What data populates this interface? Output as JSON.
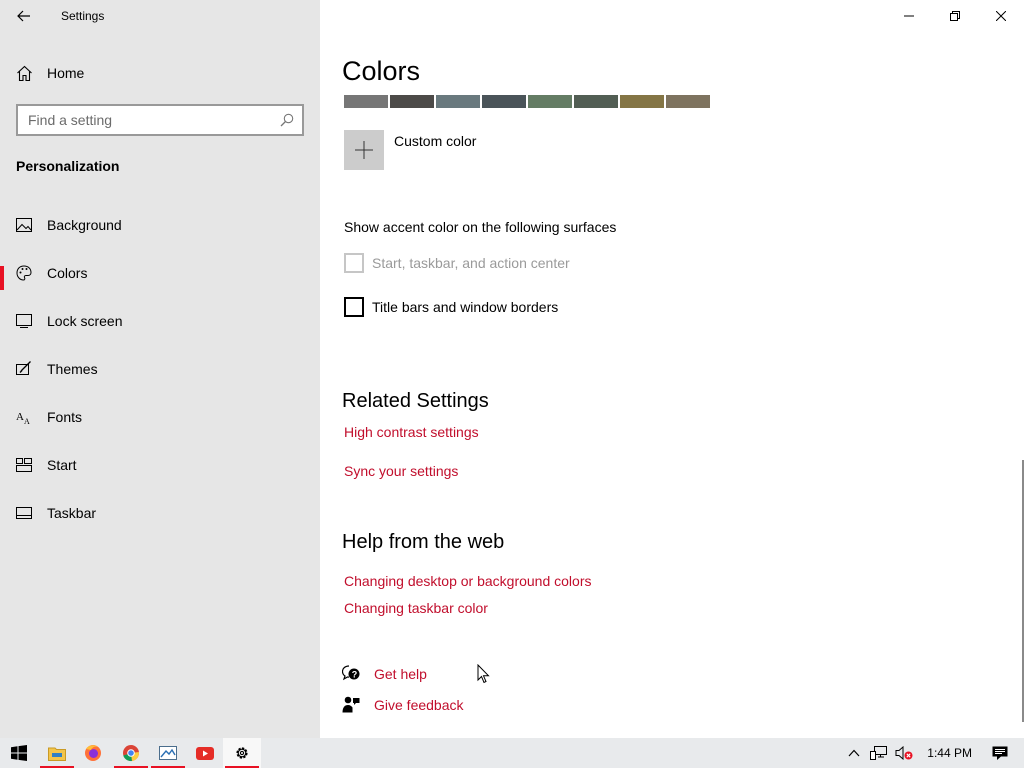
{
  "window": {
    "title": "Settings",
    "accent_color": "#c10e2c",
    "selection_color": "#e81123"
  },
  "sidebar": {
    "home_label": "Home",
    "search_placeholder": "Find a setting",
    "section_title": "Personalization",
    "items": [
      {
        "label": "Background",
        "icon": "picture-icon"
      },
      {
        "label": "Colors",
        "icon": "palette-icon",
        "selected": true
      },
      {
        "label": "Lock screen",
        "icon": "lock-screen-icon"
      },
      {
        "label": "Themes",
        "icon": "themes-icon"
      },
      {
        "label": "Fonts",
        "icon": "fonts-icon"
      },
      {
        "label": "Start",
        "icon": "start-icon"
      },
      {
        "label": "Taskbar",
        "icon": "taskbar-icon"
      }
    ]
  },
  "main": {
    "title": "Colors",
    "swatches": [
      "#767676",
      "#4c4a48",
      "#69797e",
      "#4a5459",
      "#647c64",
      "#525e54",
      "#847545",
      "#7e735f"
    ],
    "custom_color_label": "Custom color",
    "surfaces_label": "Show accent color on the following surfaces",
    "checkboxes": [
      {
        "label": "Start, taskbar, and action center",
        "checked": false,
        "disabled": true
      },
      {
        "label": "Title bars and window borders",
        "checked": false,
        "disabled": false
      }
    ],
    "related_title": "Related Settings",
    "related_links": [
      "High contrast settings",
      "Sync your settings"
    ],
    "help_title": "Help from the web",
    "help_links": [
      "Changing desktop or background colors",
      "Changing taskbar color"
    ],
    "get_help": "Get help",
    "give_feedback": "Give feedback"
  },
  "taskbar": {
    "apps": [
      "start-icon",
      "file-explorer-icon",
      "firefox-icon",
      "chrome-icon",
      "photos-icon",
      "youtube-icon",
      "settings-icon"
    ],
    "clock": "1:44 PM"
  }
}
